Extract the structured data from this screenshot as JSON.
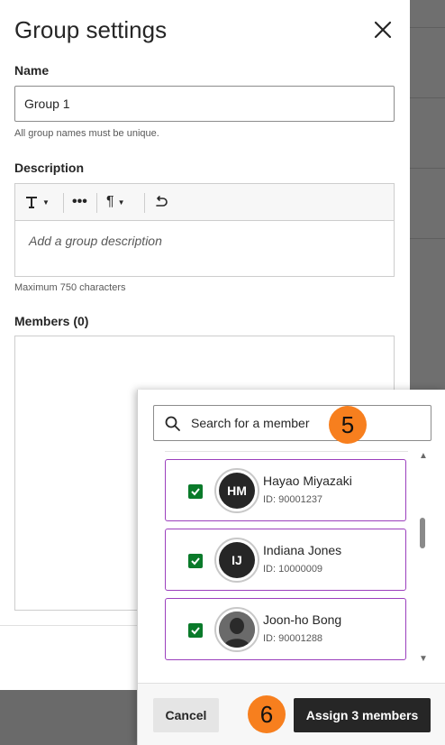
{
  "dialog": {
    "title": "Group settings",
    "close_icon": "close-icon"
  },
  "name_field": {
    "label": "Name",
    "value": "Group 1",
    "hint": "All group names must be unique."
  },
  "description": {
    "label": "Description",
    "toolbar": [
      "text-format-icon",
      "more-icon",
      "paragraph-icon",
      "undo-icon"
    ],
    "placeholder": "Add a group description",
    "hint": "Maximum 750 characters"
  },
  "members": {
    "label": "Members (0)"
  },
  "member_picker": {
    "search_placeholder": "Search for a member",
    "step_badge_search": "5",
    "items": [
      {
        "initials": "HM",
        "name": "Hayao Miyazaki",
        "id": "ID: 90001237",
        "checked": true
      },
      {
        "initials": "IJ",
        "name": "Indiana Jones",
        "id": "ID: 10000009",
        "checked": true
      },
      {
        "initials": "",
        "name": "Joon-ho Bong",
        "id": "ID: 90001288",
        "checked": true,
        "avatar": "person-photo"
      }
    ],
    "cancel_label": "Cancel",
    "assign_label": "Assign 3 members",
    "step_badge_assign": "6"
  },
  "colors": {
    "accent_badge": "#f77f1e",
    "check_green": "#0a7a2a",
    "item_border": "#9b3fbd",
    "primary_button": "#262626"
  }
}
